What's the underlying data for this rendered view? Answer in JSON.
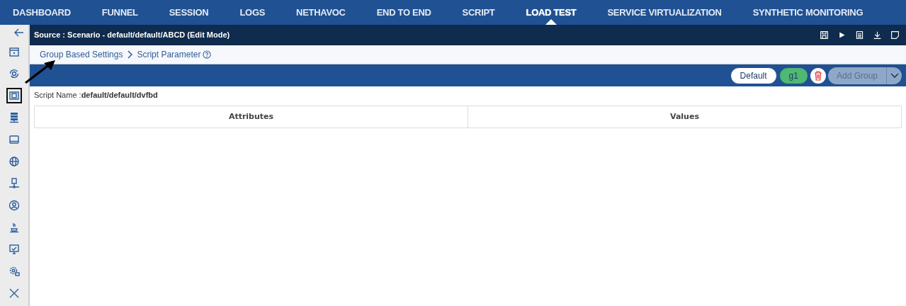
{
  "nav": {
    "tabs": [
      {
        "label": "DASHBOARD",
        "selected": false
      },
      {
        "label": "FUNNEL",
        "selected": false
      },
      {
        "label": "SESSION",
        "selected": false
      },
      {
        "label": "LOGS",
        "selected": false
      },
      {
        "label": "NETHAVOC",
        "selected": false
      },
      {
        "label": "END TO END",
        "selected": false
      },
      {
        "label": "SCRIPT",
        "selected": false
      },
      {
        "label": "LOAD TEST",
        "selected": true
      },
      {
        "label": "SERVICE VIRTUALIZATION",
        "selected": false
      },
      {
        "label": "SYNTHETIC MONITORING",
        "selected": false
      }
    ]
  },
  "sidebar": {
    "items": [
      {
        "selected": false
      },
      {
        "selected": false
      },
      {
        "selected": true
      },
      {
        "selected": false
      },
      {
        "selected": false
      },
      {
        "selected": false
      },
      {
        "selected": false
      },
      {
        "selected": false
      },
      {
        "selected": false
      },
      {
        "selected": false
      },
      {
        "selected": false
      },
      {
        "selected": false
      }
    ]
  },
  "source_bar": {
    "title": "Source : Scenario - default/default/ABCD (Edit Mode)"
  },
  "breadcrumb": [
    "Group Based Settings",
    "Script Parameter"
  ],
  "toolbar": {
    "groups": [
      {
        "label": "Default",
        "selected": false
      },
      {
        "label": "g1",
        "selected": true
      }
    ],
    "add_group": {
      "label": "Add Group",
      "disabled": true
    }
  },
  "script_name": "Script Name :**default/default/dvfbd**",
  "table": {
    "columns": [
      "Attributes",
      "Values"
    ]
  }
}
